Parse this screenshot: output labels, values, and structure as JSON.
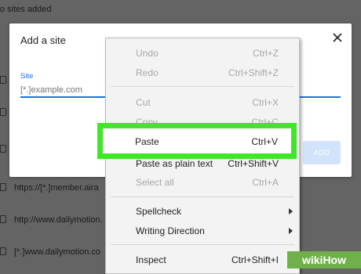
{
  "background": {
    "no_sites_text": "o sites added",
    "sites": [
      "https://[*.]member.aira",
      "http://www.dailymotion.",
      "[*.]www.dailymotion.co"
    ]
  },
  "dialog": {
    "title": "Add a site",
    "close_icon": "close-icon",
    "site_label": "Site",
    "site_placeholder": "[*.]example.com",
    "add_label": "ADD"
  },
  "context_menu": {
    "items": [
      {
        "label": "Undo",
        "shortcut": "Ctrl+Z"
      },
      {
        "label": "Redo",
        "shortcut": "Ctrl+Shift+Z"
      },
      {
        "label": "Cut",
        "shortcut": "Ctrl+X"
      },
      {
        "label": "Copy",
        "shortcut": "Ctrl+C"
      },
      {
        "label": "Paste",
        "shortcut": "Ctrl+V"
      },
      {
        "label": "Paste as plain text",
        "shortcut": "Ctrl+Shift+V"
      },
      {
        "label": "Select all",
        "shortcut": "Ctrl+A"
      },
      {
        "label": "Spellcheck"
      },
      {
        "label": "Writing Direction"
      },
      {
        "label": "Inspect",
        "shortcut": "Ctrl+Shift+I"
      }
    ]
  },
  "watermark": "wikiHow",
  "colors": {
    "highlight": "#3fe826",
    "accent": "#1a73e8",
    "watermark_bg": "#6fb04a"
  }
}
